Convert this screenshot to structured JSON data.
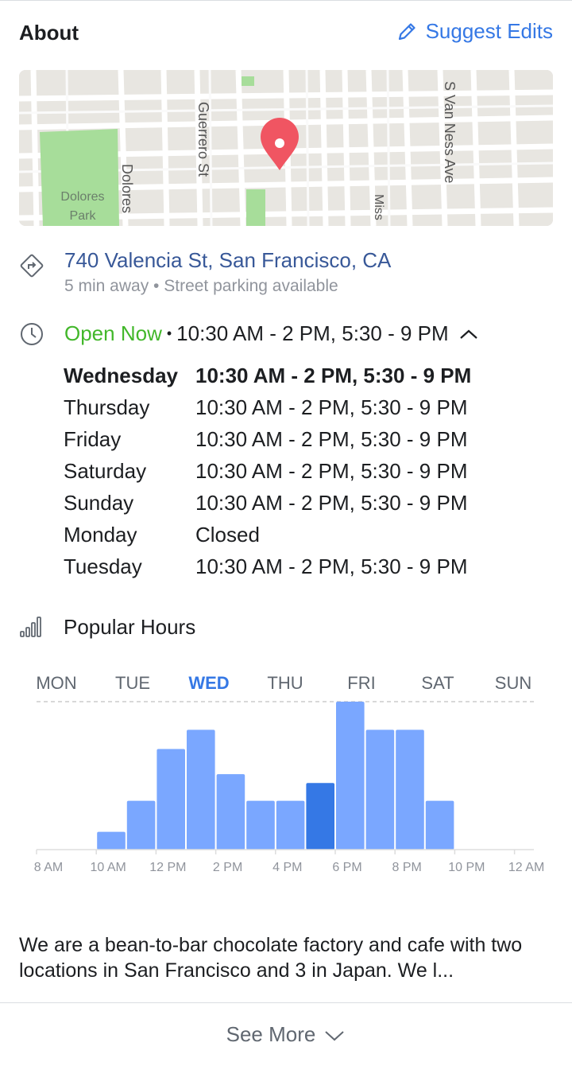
{
  "header": {
    "title": "About",
    "suggest_label": "Suggest Edits"
  },
  "map": {
    "labels": {
      "park1": "Dolores",
      "park2": "Park",
      "dolores_st": "Dolores",
      "guerrero": "Guerrero  St",
      "mission": "Miss",
      "van_ness": "S Van Ness  Ave"
    }
  },
  "location": {
    "address": "740 Valencia St, San Francisco, CA",
    "subtext": "5 min away • Street parking available"
  },
  "hours": {
    "status": "Open Now",
    "separator": "•",
    "today_hours": "10:30 AM - 2 PM, 5:30 - 9 PM",
    "days": [
      {
        "day": "Wednesday",
        "hours": "10:30 AM - 2 PM, 5:30 - 9 PM",
        "today": true
      },
      {
        "day": "Thursday",
        "hours": "10:30 AM - 2 PM, 5:30 - 9 PM"
      },
      {
        "day": "Friday",
        "hours": "10:30 AM - 2 PM, 5:30 - 9 PM"
      },
      {
        "day": "Saturday",
        "hours": "10:30 AM - 2 PM, 5:30 - 9 PM"
      },
      {
        "day": "Sunday",
        "hours": "10:30 AM - 2 PM, 5:30 - 9 PM"
      },
      {
        "day": "Monday",
        "hours": "Closed"
      },
      {
        "day": "Tuesday",
        "hours": "10:30 AM - 2 PM, 5:30 - 9 PM"
      }
    ]
  },
  "popular": {
    "label": "Popular Hours"
  },
  "chart_data": {
    "type": "bar",
    "day_tabs": [
      "MON",
      "TUE",
      "WED",
      "THU",
      "FRI",
      "SAT",
      "SUN"
    ],
    "selected_day": "WED",
    "x_tick_labels": [
      "8 AM",
      "10 AM",
      "12 PM",
      "2 PM",
      "4 PM",
      "6 PM",
      "8 PM",
      "10 PM",
      "12 AM"
    ],
    "categories": [
      "8 AM",
      "9 AM",
      "10 AM",
      "11 AM",
      "12 PM",
      "1 PM",
      "2 PM",
      "3 PM",
      "4 PM",
      "5 PM",
      "6 PM",
      "7 PM",
      "8 PM",
      "9 PM",
      "10 PM",
      "11 PM"
    ],
    "values": [
      0,
      0,
      12,
      33,
      68,
      81,
      51,
      33,
      33,
      45,
      100,
      81,
      81,
      33,
      0,
      0
    ],
    "highlight_index": 9,
    "ylim": [
      0,
      100
    ],
    "colors": {
      "bar": "#7aa7ff",
      "highlight": "#3578e5",
      "selected_tab": "#3578e5",
      "tab": "#606770",
      "axis_text": "#90949c"
    }
  },
  "description": {
    "text": "We are a bean-to-bar chocolate factory and cafe with two locations in San Francisco and 3 in Japan. We l..."
  },
  "footer": {
    "see_more_label": "See More"
  }
}
